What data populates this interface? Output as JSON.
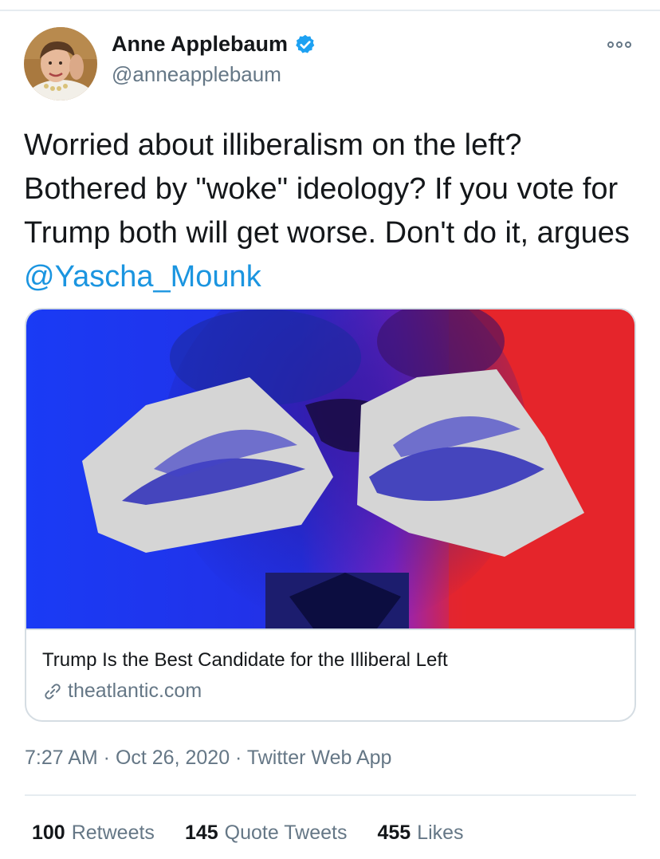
{
  "author": {
    "name": "Anne Applebaum",
    "handle": "@anneapplebaum",
    "verified": true
  },
  "tweet": {
    "text_before_mention": "Worried about illiberalism on the left? Bothered by \"woke\" ideology? If you vote for Trump both will get worse. Don't do it, argues ",
    "mention": "@Yascha_Mounk"
  },
  "card": {
    "title": "Trump Is the Best Candidate for the Illiberal Left",
    "domain": "theatlantic.com",
    "image_icon": "card-image"
  },
  "meta": {
    "text": "7:27 AM · Oct 26, 2020 · Twitter Web App"
  },
  "stats": [
    {
      "count": "100",
      "label": "Retweets"
    },
    {
      "count": "145",
      "label": "Quote Tweets"
    },
    {
      "count": "455",
      "label": "Likes"
    }
  ],
  "colors": {
    "link": "#1b95e0",
    "secondary_text": "#657786",
    "verified": "#1da1f2",
    "image_blue": "#1a2fe0",
    "image_red": "#e5262b"
  },
  "icons": {
    "verified": "verified-badge-icon",
    "more": "more-options-icon",
    "link": "link-icon"
  }
}
